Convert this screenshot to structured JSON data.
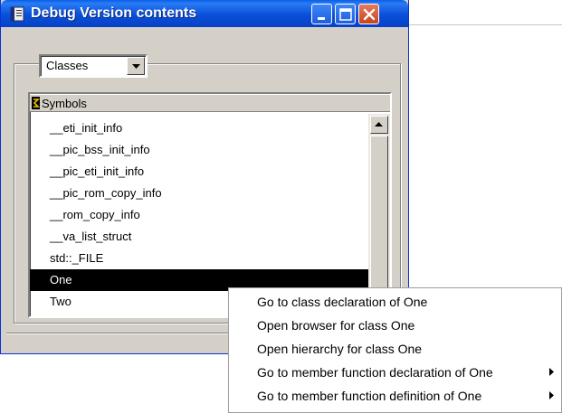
{
  "window": {
    "title": "Debug Version contents"
  },
  "combo": {
    "selected": "Classes"
  },
  "list": {
    "header": "Symbols",
    "items": [
      "__eti_init_info",
      "__pic_bss_init_info",
      "__pic_eti_init_info",
      "__pic_rom_copy_info",
      "__rom_copy_info",
      "__va_list_struct",
      "std::_FILE",
      "One",
      "Two"
    ],
    "selected_item": "One"
  },
  "context_menu": {
    "items": [
      {
        "label": "Go to class declaration of One",
        "submenu": false
      },
      {
        "label": "Open browser for class One",
        "submenu": false
      },
      {
        "label": "Open hierarchy for class One",
        "submenu": false
      },
      {
        "label": "Go to member function declaration of One",
        "submenu": true
      },
      {
        "label": "Go to member function definition of One",
        "submenu": true
      }
    ]
  },
  "colors": {
    "titlebar": "#0a4fd8",
    "close_button": "#c8431f",
    "window_face": "#d4d0c8",
    "selection": "#000000"
  },
  "icons": {
    "app": "book-icon",
    "header": "symbol-icon",
    "minimize": "minimize-icon",
    "maximize": "maximize-icon",
    "close": "close-icon",
    "dropdown": "chevron-down-icon",
    "scroll_up": "scroll-up-arrow-icon",
    "submenu": "submenu-arrow-icon"
  }
}
